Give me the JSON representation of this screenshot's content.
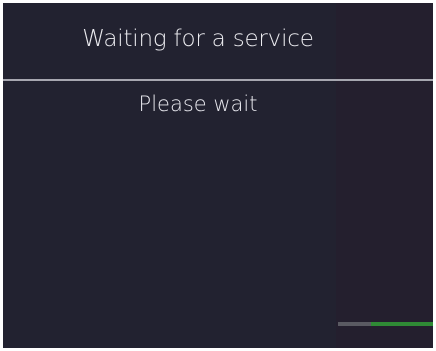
{
  "dialog": {
    "title": "Waiting for a service",
    "message": "Please wait"
  },
  "colors": {
    "background": "#222230",
    "panel": "#241f2e",
    "text": "#ececf0",
    "divider": "#a7a7b0",
    "progress_accent": "#2f8a35"
  }
}
